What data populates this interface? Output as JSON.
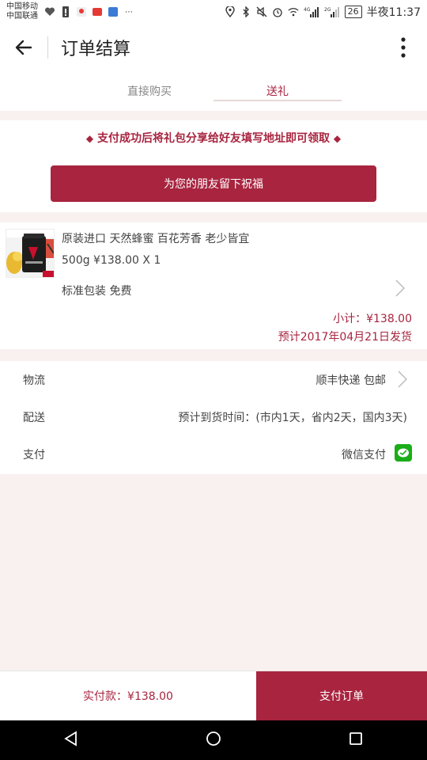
{
  "status_bar": {
    "carrier_1": "中国移动",
    "carrier_2": "中国联通",
    "battery": "26",
    "time": "半夜11:37",
    "net_label_1": "4G",
    "net_label_2": "2G"
  },
  "app_bar": {
    "title": "订单结算"
  },
  "tabs": [
    {
      "label": "直接购买",
      "active": false
    },
    {
      "label": "送礼",
      "active": true
    }
  ],
  "gift": {
    "notice": "支付成功后将礼包分享给好友填写地址即可领取",
    "bless_button": "为您的朋友留下祝福"
  },
  "product": {
    "name": "原装进口 天然蜂蜜 百花芳香 老少皆宜",
    "spec": "500g ¥138.00 X 1",
    "packaging": "标准包装 免费",
    "subtotal": "小计：¥138.00",
    "ship_date": "预计2017年04月21日发货"
  },
  "info_rows": {
    "logistics_label": "物流",
    "logistics_value": "顺丰快递 包邮",
    "delivery_label": "配送",
    "delivery_value": "预计到货时间：(市内1天，省内2天，国内3天)",
    "payment_label": "支付",
    "payment_value": "微信支付"
  },
  "footer": {
    "total": "实付款：¥138.00",
    "pay_button": "支付订单"
  },
  "colors": {
    "accent": "#a8243f",
    "background": "#f8f1f0",
    "wechat_green": "#1aad19"
  }
}
